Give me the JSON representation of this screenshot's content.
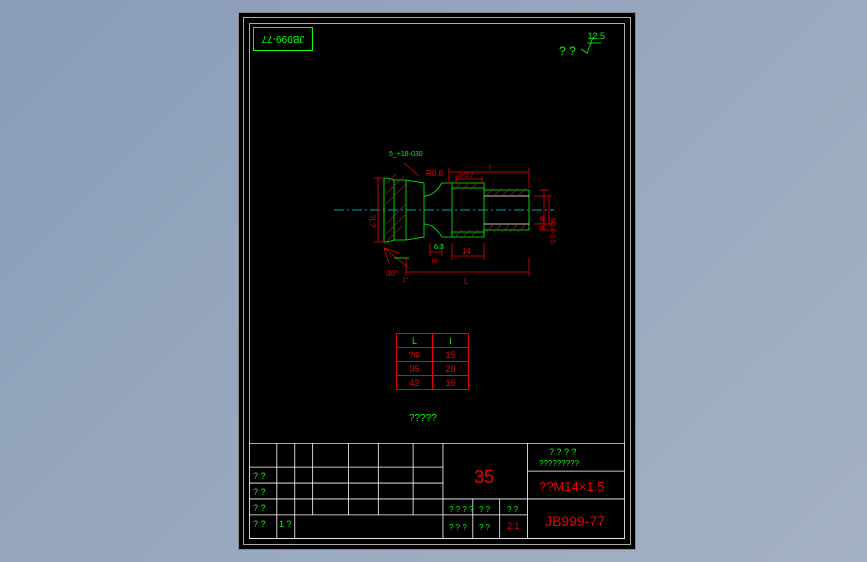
{
  "document": {
    "standard": "JB999-77",
    "standard_rotated": "JB999-77",
    "surface_mark": "12.5",
    "surface_prefix": "? ?"
  },
  "drawing": {
    "callout_top": "5_+18-030",
    "radius": "R0.8",
    "dim_top_l": "l",
    "dim_top_gap": "2-0.7",
    "dim_right": "M14-1.5",
    "dim_phi": "Φ16",
    "dim_left": "?L?",
    "dim_bot_14": "14",
    "dim_bot_L": "L",
    "angle": "30°",
    "angle2": "1°",
    "dim_h": "H",
    "rough": "6.3"
  },
  "table": {
    "headers": [
      "L",
      "l"
    ],
    "rows": [
      [
        "?Φ",
        "15"
      ],
      [
        "35",
        "20"
      ],
      [
        "42",
        "15"
      ]
    ]
  },
  "note": "?????",
  "titleblock": {
    "left_labels": [
      "? ?",
      "? ?",
      "? ?",
      "? ?",
      "1 ?"
    ],
    "cols": [
      "? ? ?",
      "? ? ?",
      "? ? ?",
      "? ? ?"
    ],
    "main_num": "35",
    "mid_labels": [
      "? ? ? ?",
      "? ?",
      "? ?"
    ],
    "bot_labels": [
      "? ? ?",
      "? ?"
    ],
    "company": "? ? ? ?",
    "description": "?????????",
    "spec": "??M14×1.5",
    "code": "JB999-77",
    "scale": "2:1"
  },
  "chart_data": {
    "type": "table",
    "title": "",
    "columns": [
      "L",
      "l"
    ],
    "rows": [
      [
        "?Φ",
        "15"
      ],
      [
        "35",
        "20"
      ],
      [
        "42",
        "15"
      ]
    ]
  }
}
